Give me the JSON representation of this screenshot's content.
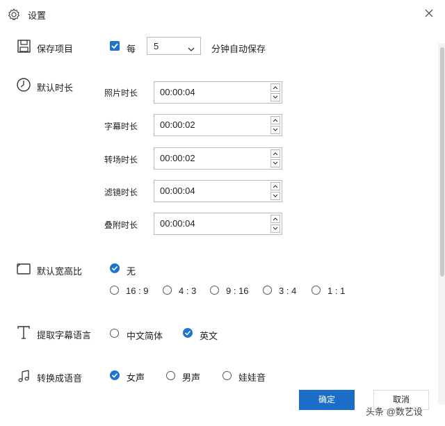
{
  "dialog": {
    "title": "设置",
    "icon": "gear-icon",
    "close_icon": "close-icon"
  },
  "autosave": {
    "section_label": "保存项目",
    "icon": "floppy-disk-icon",
    "checkbox_checked": true,
    "every_label": "每",
    "interval_value": "5",
    "suffix_label": "分钟自动保存"
  },
  "default_duration": {
    "section_label": "默认时长",
    "icon": "clock-icon",
    "items": [
      {
        "label": "照片时长",
        "value": "00:00:04"
      },
      {
        "label": "字幕时长",
        "value": "00:00:02"
      },
      {
        "label": "转场时长",
        "value": "00:00:02"
      },
      {
        "label": "滤镜时长",
        "value": "00:00:04"
      },
      {
        "label": "叠附时长",
        "value": "00:00:04"
      }
    ]
  },
  "aspect_ratio": {
    "section_label": "默认宽高比",
    "icon": "aspect-frame-icon",
    "none_label": "无",
    "none_selected": true,
    "options": [
      "16 : 9",
      "4 : 3",
      "9 : 16",
      "3 : 4",
      "1 : 1"
    ]
  },
  "subtitle_language": {
    "section_label": "提取字幕语言",
    "icon": "text-t-icon",
    "options": [
      {
        "label": "中文简体",
        "selected": false
      },
      {
        "label": "英文",
        "selected": true
      }
    ]
  },
  "tts": {
    "section_label": "转换成语音",
    "icon": "music-note-icon",
    "options": [
      {
        "label": "女声",
        "selected": true
      },
      {
        "label": "男声",
        "selected": false
      },
      {
        "label": "娃娃音",
        "selected": false
      }
    ]
  },
  "buttons": {
    "ok": "确定",
    "cancel": "取消"
  },
  "watermark": "头条 @数艺设",
  "colors": {
    "accent": "#1e74d0",
    "primary_button": "#1a6ec8"
  }
}
